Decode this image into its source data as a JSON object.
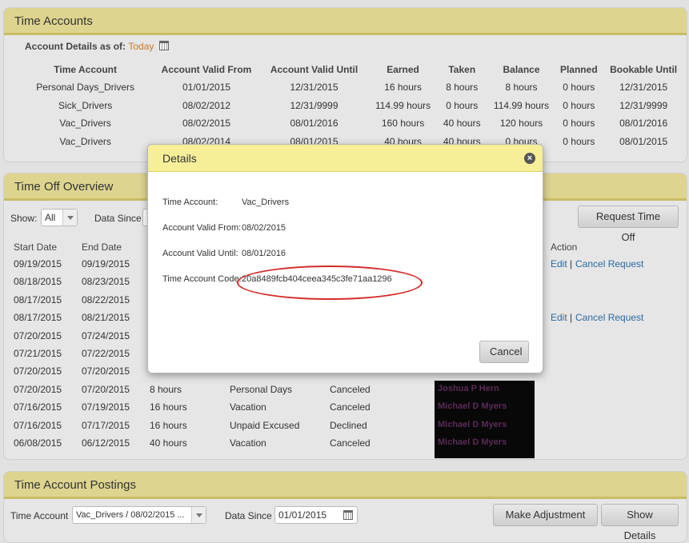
{
  "accounts_panel": {
    "title": "Time Accounts",
    "details_label": "Account Details as of:",
    "details_date": "Today",
    "columns": [
      "Time Account",
      "Account Valid From",
      "Account Valid Until",
      "Earned",
      "Taken",
      "Balance",
      "Planned",
      "Bookable Until"
    ],
    "rows": [
      [
        "Personal Days_Drivers",
        "01/01/2015",
        "12/31/2015",
        "16 hours",
        "8 hours",
        "8 hours",
        "0 hours",
        "12/31/2015"
      ],
      [
        "Sick_Drivers",
        "08/02/2012",
        "12/31/9999",
        "114.99 hours",
        "0 hours",
        "114.99 hours",
        "0 hours",
        "12/31/9999"
      ],
      [
        "Vac_Drivers",
        "08/02/2015",
        "08/01/2016",
        "160 hours",
        "40 hours",
        "120 hours",
        "0 hours",
        "08/01/2016"
      ],
      [
        "Vac_Drivers",
        "08/02/2014",
        "08/01/2015",
        "40 hours",
        "40 hours",
        "0 hours",
        "0 hours",
        "08/01/2015"
      ]
    ]
  },
  "overview_panel": {
    "title": "Time Off Overview",
    "show_label": "Show:",
    "show_value": "All",
    "data_since_label": "Data Since",
    "request_button": "Request Time Off",
    "col_start": "Start Date",
    "col_end": "End Date",
    "col_action": "Action",
    "action_edit": "Edit",
    "action_sep": "|",
    "action_cancel": "Cancel Request",
    "rows": [
      {
        "start": "09/19/2015",
        "end": "09/19/2015",
        "hours": "",
        "type": "",
        "status": "",
        "approver": "",
        "actions": true
      },
      {
        "start": "08/18/2015",
        "end": "08/23/2015",
        "hours": "",
        "type": "",
        "status": "",
        "approver": "",
        "actions": false
      },
      {
        "start": "08/17/2015",
        "end": "08/22/2015",
        "hours": "",
        "type": "",
        "status": "",
        "approver": "",
        "actions": false
      },
      {
        "start": "08/17/2015",
        "end": "08/21/2015",
        "hours": "",
        "type": "",
        "status": "",
        "approver": "",
        "actions": true
      },
      {
        "start": "07/20/2015",
        "end": "07/24/2015",
        "hours": "",
        "type": "",
        "status": "",
        "approver": "",
        "actions": false
      },
      {
        "start": "07/21/2015",
        "end": "07/22/2015",
        "hours": "",
        "type": "",
        "status": "",
        "approver": "",
        "actions": false
      },
      {
        "start": "07/20/2015",
        "end": "07/20/2015",
        "hours": "",
        "type": "",
        "status": "",
        "approver": "",
        "actions": false
      },
      {
        "start": "07/20/2015",
        "end": "07/20/2015",
        "hours": "8 hours",
        "type": "Personal Days",
        "status": "Canceled",
        "approver": "Joshua P Hern",
        "actions": false
      },
      {
        "start": "07/16/2015",
        "end": "07/19/2015",
        "hours": "16 hours",
        "type": "Vacation",
        "status": "Canceled",
        "approver": "Michael D Myers",
        "actions": false
      },
      {
        "start": "07/16/2015",
        "end": "07/17/2015",
        "hours": "16 hours",
        "type": "Unpaid Excused",
        "status": "Declined",
        "approver": "Michael D Myers",
        "actions": false
      },
      {
        "start": "06/08/2015",
        "end": "06/12/2015",
        "hours": "40 hours",
        "type": "Vacation",
        "status": "Canceled",
        "approver": "Michael D Myers",
        "actions": false
      }
    ]
  },
  "postings_panel": {
    "title": "Time Account Postings",
    "time_account_label": "Time Account",
    "time_account_value": "Vac_Drivers / 08/02/2015 ...",
    "data_since_label": "Data Since",
    "data_since_value": "01/01/2015",
    "make_adjustment_button": "Make Adjustment",
    "show_details_button": "Show Details"
  },
  "modal": {
    "title": "Details",
    "close_symbol": "×",
    "time_account_label": "Time Account:",
    "time_account_value": "Vac_Drivers",
    "valid_from_label": "Account Valid From:",
    "valid_from_value": "08/02/2015",
    "valid_until_label": "Account Valid Until:",
    "valid_until_value": "08/01/2016",
    "code_label": "Time Account Code:",
    "code_value": "20a8489fcb404ceea345c3fe71aa1296",
    "cancel_button": "Cancel"
  },
  "colors": {
    "panel_header": "#ddd48f",
    "modal_header": "#f7ee98",
    "link": "#2a6aa3",
    "highlight": "#d42a2a"
  }
}
